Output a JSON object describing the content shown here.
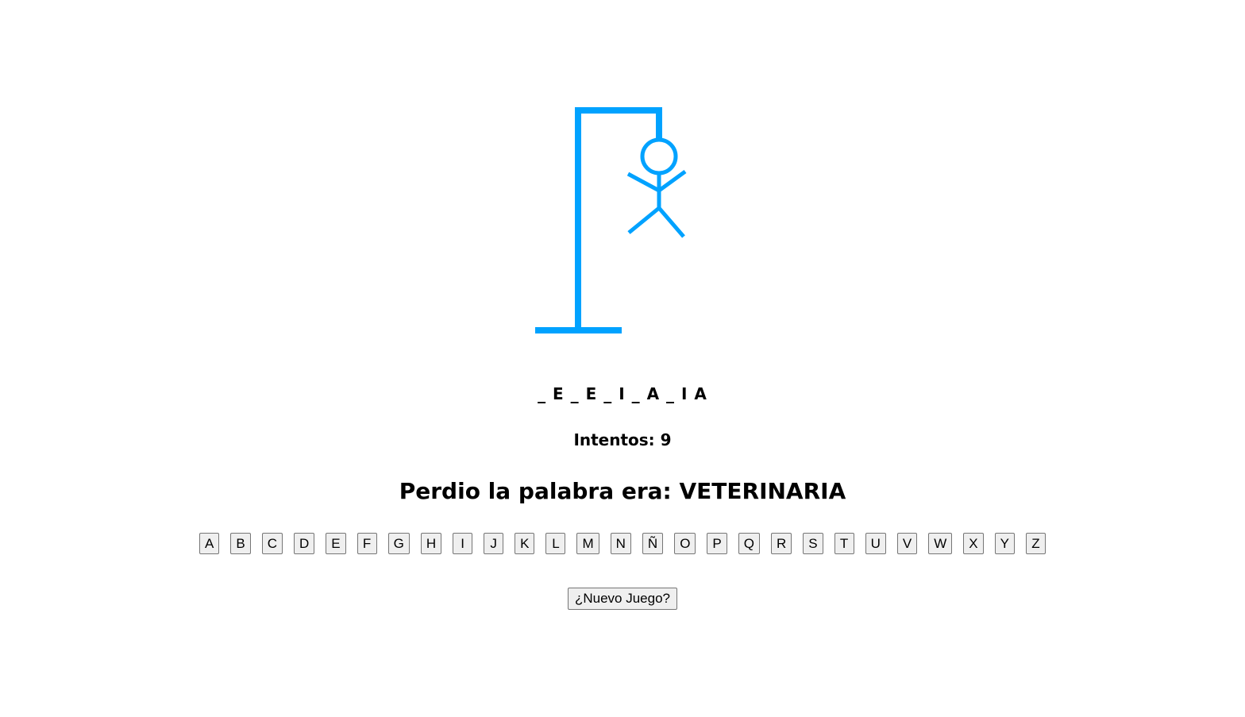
{
  "game": {
    "accent_color": "#00a2ff",
    "word_display": "_ E _ E _ I _ A _ I A",
    "attempts_text": "Intentos: 9",
    "result_text": "Perdio la palabra era: VETERINARIA"
  },
  "keyboard": {
    "letters": [
      "A",
      "B",
      "C",
      "D",
      "E",
      "F",
      "G",
      "H",
      "I",
      "J",
      "K",
      "L",
      "M",
      "N",
      "Ñ",
      "O",
      "P",
      "Q",
      "R",
      "S",
      "T",
      "U",
      "V",
      "W",
      "X",
      "Y",
      "Z"
    ]
  },
  "new_game_label": "¿Nuevo Juego?",
  "drawing": {
    "icon": "hangman-figure-icon"
  }
}
